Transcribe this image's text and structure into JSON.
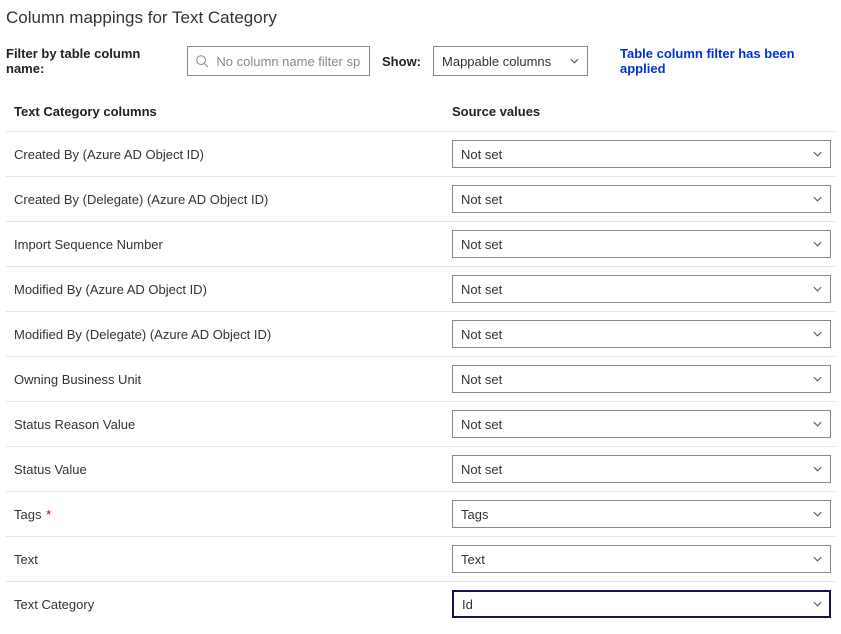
{
  "title": "Column mappings for Text Category",
  "filter": {
    "label": "Filter by table column name:",
    "placeholder": "No column name filter sp..."
  },
  "show": {
    "label": "Show:",
    "value": "Mappable columns"
  },
  "appliedMessage": "Table column filter has been applied",
  "headers": {
    "left": "Text Category columns",
    "right": "Source values"
  },
  "rows": [
    {
      "label": "Created By (Azure AD Object ID)",
      "value": "Not set",
      "required": false,
      "highlight": false
    },
    {
      "label": "Created By (Delegate) (Azure AD Object ID)",
      "value": "Not set",
      "required": false,
      "highlight": false
    },
    {
      "label": "Import Sequence Number",
      "value": "Not set",
      "required": false,
      "highlight": false
    },
    {
      "label": "Modified By (Azure AD Object ID)",
      "value": "Not set",
      "required": false,
      "highlight": false
    },
    {
      "label": "Modified By (Delegate) (Azure AD Object ID)",
      "value": "Not set",
      "required": false,
      "highlight": false
    },
    {
      "label": "Owning Business Unit",
      "value": "Not set",
      "required": false,
      "highlight": false
    },
    {
      "label": "Status Reason Value",
      "value": "Not set",
      "required": false,
      "highlight": false
    },
    {
      "label": "Status Value",
      "value": "Not set",
      "required": false,
      "highlight": false
    },
    {
      "label": "Tags",
      "value": "Tags",
      "required": true,
      "highlight": false
    },
    {
      "label": "Text",
      "value": "Text",
      "required": false,
      "highlight": false
    },
    {
      "label": "Text Category",
      "value": "Id",
      "required": false,
      "highlight": true
    }
  ]
}
